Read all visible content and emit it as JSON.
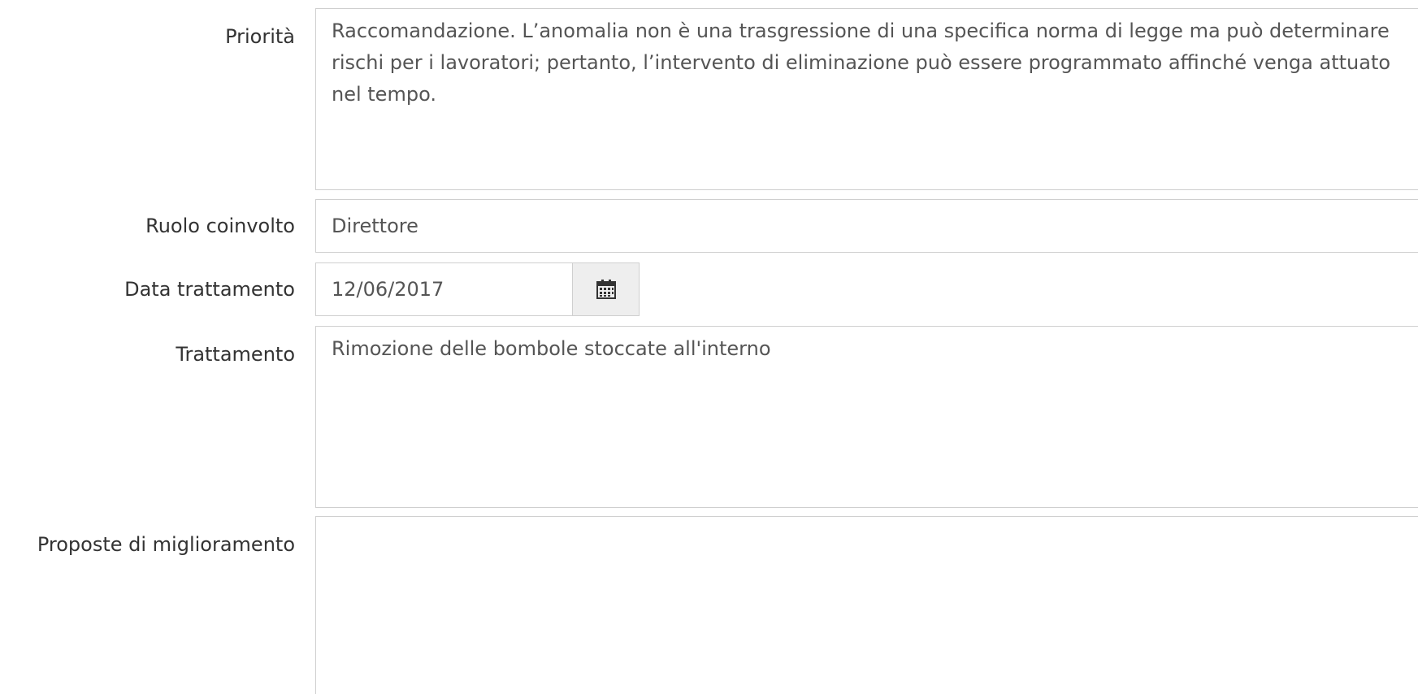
{
  "form": {
    "priorita": {
      "label": "Priorità",
      "value": "Raccomandazione. L’anomalia non è una trasgressione di una specifica norma di legge ma può determinare rischi per i lavoratori; pertanto, l’intervento di eliminazione può essere programmato affinché venga attuato nel tempo."
    },
    "ruolo": {
      "label": "Ruolo coinvolto",
      "value": "Direttore"
    },
    "data_trattamento": {
      "label": "Data trattamento",
      "value": "12/06/2017",
      "icon": "calendar-icon"
    },
    "trattamento": {
      "label": "Trattamento",
      "value": "Rimozione delle bombole stoccate all'interno"
    },
    "proposte": {
      "label": "Proposte di miglioramento",
      "value": ""
    }
  }
}
